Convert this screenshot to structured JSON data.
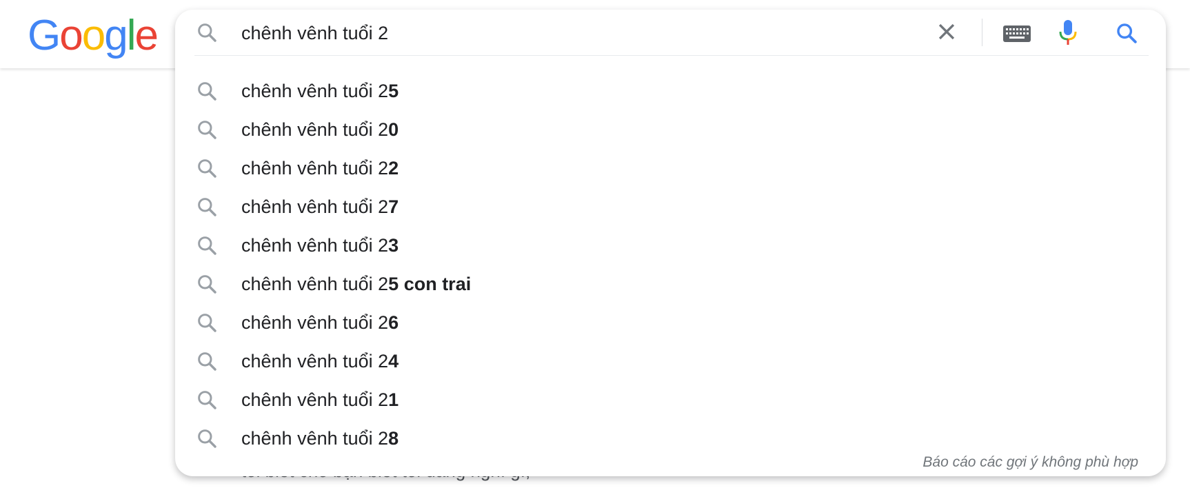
{
  "logo": {
    "text": "Google"
  },
  "search": {
    "query": "chênh vênh tuổi 2",
    "icons": {
      "leading": "search-icon",
      "clear": "close-icon",
      "keyboard": "keyboard-icon",
      "voice": "microphone-icon",
      "submit": "search-icon"
    }
  },
  "suggestions": [
    {
      "prefix": "chênh vênh tuổi 2",
      "completion": "5"
    },
    {
      "prefix": "chênh vênh tuổi 2",
      "completion": "0"
    },
    {
      "prefix": "chênh vênh tuổi 2",
      "completion": "2"
    },
    {
      "prefix": "chênh vênh tuổi 2",
      "completion": "7"
    },
    {
      "prefix": "chênh vênh tuổi 2",
      "completion": "3"
    },
    {
      "prefix": "chênh vênh tuổi 2",
      "completion": "5 con trai"
    },
    {
      "prefix": "chênh vênh tuổi 2",
      "completion": "6"
    },
    {
      "prefix": "chênh vênh tuổi 2",
      "completion": "4"
    },
    {
      "prefix": "chênh vênh tuổi 2",
      "completion": "1"
    },
    {
      "prefix": "chênh vênh tuổi 2",
      "completion": "8"
    }
  ],
  "report_link": "Báo cáo các gợi ý không phù hợp",
  "behind_text": "tôi biết cho bạn biết tôi đang nghĩ gì,",
  "colors": {
    "google_blue": "#4285F4",
    "google_red": "#EA4335",
    "google_yellow": "#FBBC05",
    "google_green": "#34A853",
    "icon_gray": "#9aa0a6",
    "text": "#202124"
  }
}
